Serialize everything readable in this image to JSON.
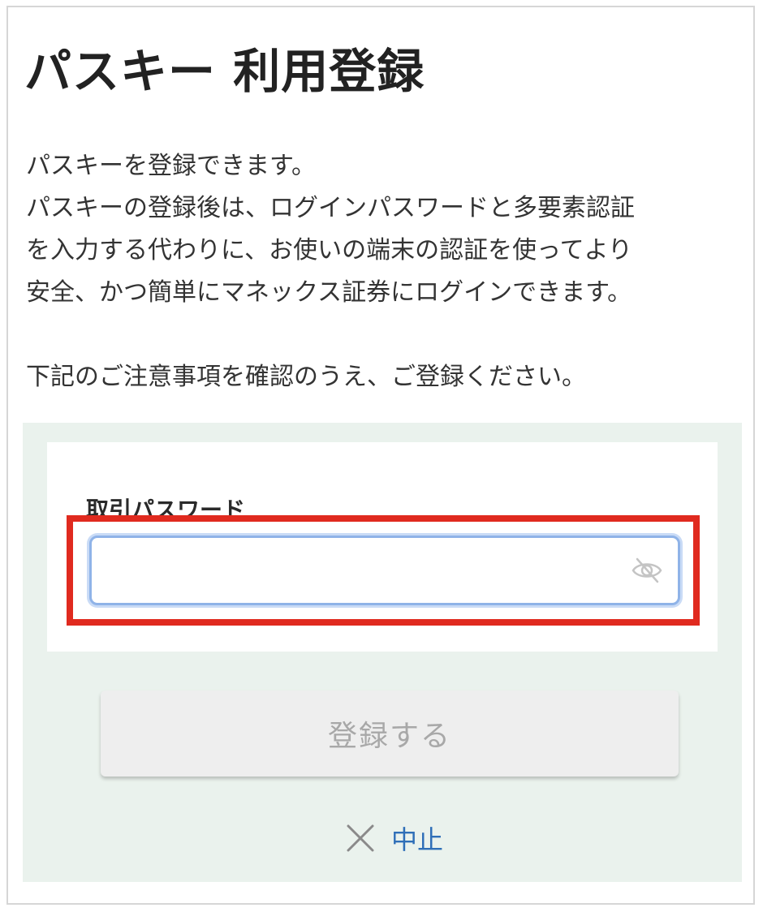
{
  "page": {
    "title": "パスキー 利用登録"
  },
  "intro": {
    "lines": [
      "パスキーを登録できます。",
      "パスキーの登録後は、ログインパスワードと多要素認証",
      "を入力する代わりに、お使いの端末の認証を使ってより",
      "安全、かつ簡単にマネックス証券にログインできます。"
    ],
    "notice": "下記のご注意事項を確認のうえ、ご登録ください。"
  },
  "form": {
    "password_label": "取引パスワード",
    "password_value": "",
    "password_placeholder": "",
    "toggle_icon": "eye-off-icon",
    "submit_label": "登録する",
    "cancel_label": "中止",
    "cancel_icon": "close-icon"
  },
  "colors": {
    "panel_bg": "#eaf2ed",
    "highlight": "#e02a1f",
    "input_focus": "#8fb3e8",
    "link": "#2f6fb8",
    "button_disabled_text": "#a8a8a8"
  }
}
